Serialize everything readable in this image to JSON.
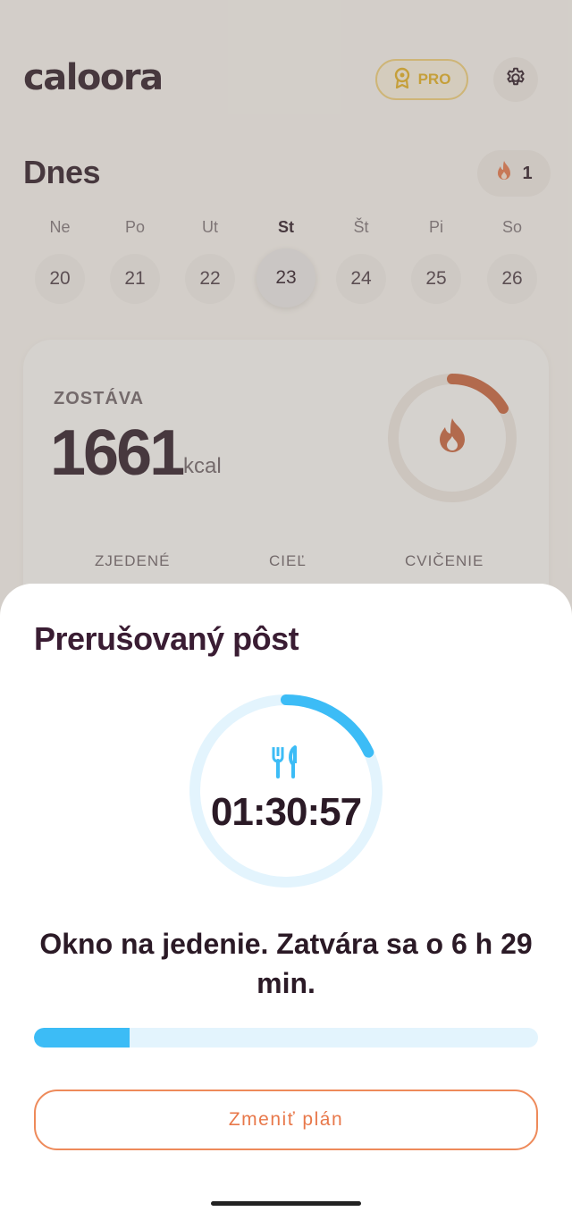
{
  "app": {
    "logo": "caloora",
    "pro_label": "PRO"
  },
  "header": {
    "title": "Dnes",
    "streak_count": "1"
  },
  "week": {
    "days": [
      {
        "label": "Ne",
        "num": "20"
      },
      {
        "label": "Po",
        "num": "21"
      },
      {
        "label": "Ut",
        "num": "22"
      },
      {
        "label": "St",
        "num": "23"
      },
      {
        "label": "Št",
        "num": "24"
      },
      {
        "label": "Pi",
        "num": "25"
      },
      {
        "label": "So",
        "num": "26"
      }
    ],
    "selected_index": 3
  },
  "calories": {
    "remaining_label": "ZOSTÁVA",
    "remaining_value": "1661",
    "unit": "kcal",
    "stats": [
      "ZJEDENÉ",
      "CIEĽ",
      "CVIČENIE"
    ]
  },
  "fasting_sheet": {
    "title": "Prerušovaný pôst",
    "timer": "01:30:57",
    "status_text": "Okno na jedenie. Zatvára sa o 6 h 29 min.",
    "ring_progress": 0.18,
    "bar_progress": 0.19,
    "change_button": "Zmeniť plán"
  },
  "colors": {
    "accent_blue": "#3cbcf6",
    "accent_orange": "#e8784a",
    "pro_gold": "#e5b21f"
  },
  "icons": {
    "pro": "award-icon",
    "settings": "gear-icon",
    "streak": "flame-icon",
    "meal": "cutlery-icon"
  }
}
